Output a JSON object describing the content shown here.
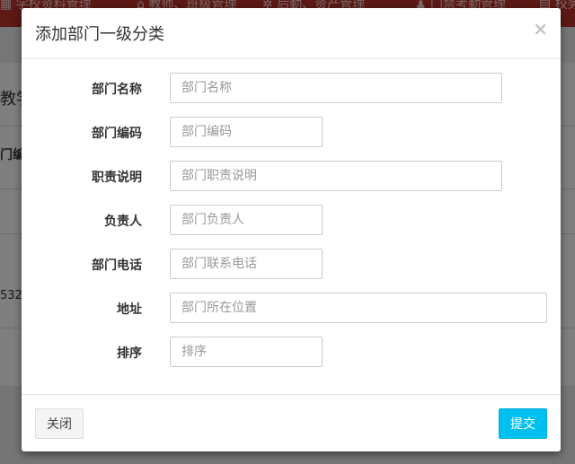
{
  "background": {
    "nav_items": [
      "学校资料管理",
      "教师、班级管理",
      "后勤、资产管理",
      "门禁考勤管理",
      "校务"
    ],
    "page_title_fragment": "教学",
    "table_header_fragment": "门编",
    "row_value_fragment": "532",
    "colors": {
      "nav_bg": "#b8322a",
      "overlay": "rgba(0,0,0,0.5)"
    }
  },
  "modal": {
    "title": "添加部门一级分类",
    "close_symbol": "×",
    "fields": [
      {
        "label": "部门名称",
        "placeholder": "部门名称",
        "value": ""
      },
      {
        "label": "部门编码",
        "placeholder": "部门编码",
        "value": ""
      },
      {
        "label": "职责说明",
        "placeholder": "部门职责说明",
        "value": ""
      },
      {
        "label": "负责人",
        "placeholder": "部门负责人",
        "value": ""
      },
      {
        "label": "部门电话",
        "placeholder": "部门联系电话",
        "value": ""
      },
      {
        "label": "地址",
        "placeholder": "部门所在位置",
        "value": ""
      },
      {
        "label": "排序",
        "placeholder": "排序",
        "value": ""
      }
    ],
    "footer": {
      "close_label": "关闭",
      "submit_label": "提交"
    },
    "colors": {
      "submit_bg": "#00c0ef",
      "close_bg": "#f4f4f4"
    }
  }
}
